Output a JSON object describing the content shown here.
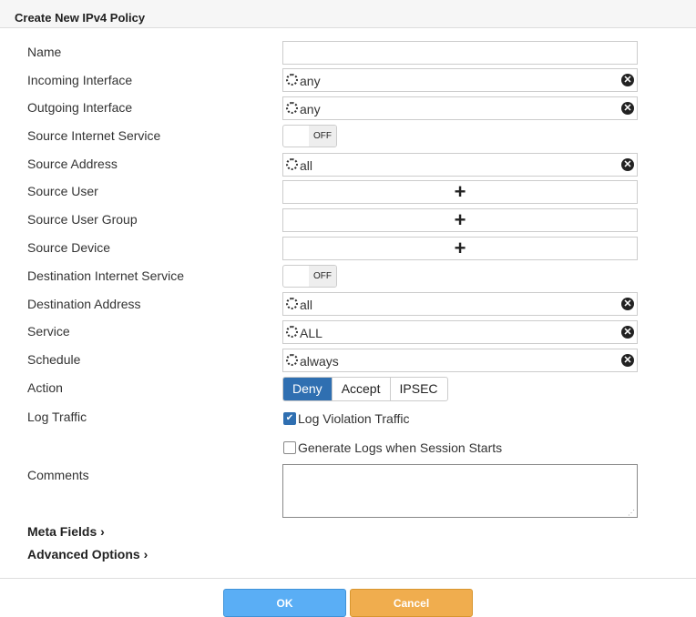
{
  "title": "Create New IPv4 Policy",
  "labels": {
    "name": "Name",
    "incoming": "Incoming Interface",
    "outgoing": "Outgoing Interface",
    "src_inet": "Source Internet Service",
    "src_addr": "Source Address",
    "src_user": "Source User",
    "src_group": "Source User Group",
    "src_device": "Source Device",
    "dst_inet": "Destination Internet Service",
    "dst_addr": "Destination Address",
    "service": "Service",
    "schedule": "Schedule",
    "action": "Action",
    "log": "Log Traffic",
    "comments": "Comments"
  },
  "values": {
    "name": "",
    "incoming": "any",
    "outgoing": "any",
    "src_addr": "all",
    "dst_addr": "all",
    "service": "ALL",
    "schedule": "always",
    "src_inet": "OFF",
    "dst_inet": "OFF"
  },
  "action": {
    "options": [
      "Deny",
      "Accept",
      "IPSEC"
    ],
    "selected": "Deny"
  },
  "log": {
    "violation": "Log Violation Traffic",
    "violation_checked": true,
    "session": "Generate Logs when Session Starts",
    "session_checked": false
  },
  "sections": {
    "meta": "Meta Fields",
    "advanced": "Advanced Options"
  },
  "buttons": {
    "ok": "OK",
    "cancel": "Cancel"
  },
  "plus": "+",
  "remove": "✕",
  "chevron": "›",
  "check": "✔"
}
